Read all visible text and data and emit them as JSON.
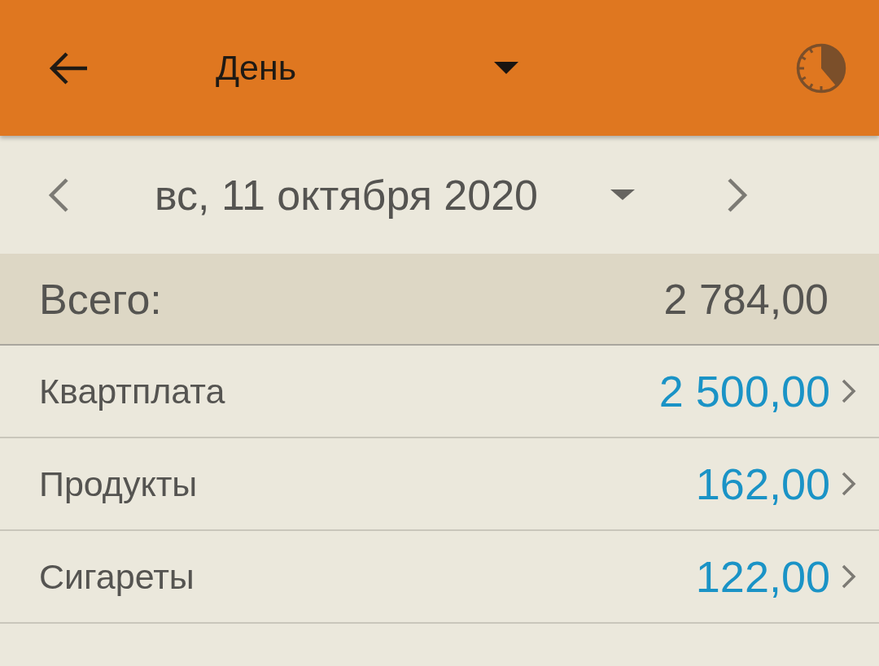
{
  "app_bar": {
    "period": "День"
  },
  "date_bar": {
    "date": "вс, 11 октября 2020"
  },
  "total": {
    "label": "Всего:",
    "amount": "2 784,00"
  },
  "categories": [
    {
      "name": "Квартплата",
      "amount": "2 500,00"
    },
    {
      "name": "Продукты",
      "amount": "162,00"
    },
    {
      "name": "Сигареты",
      "amount": "122,00"
    }
  ]
}
